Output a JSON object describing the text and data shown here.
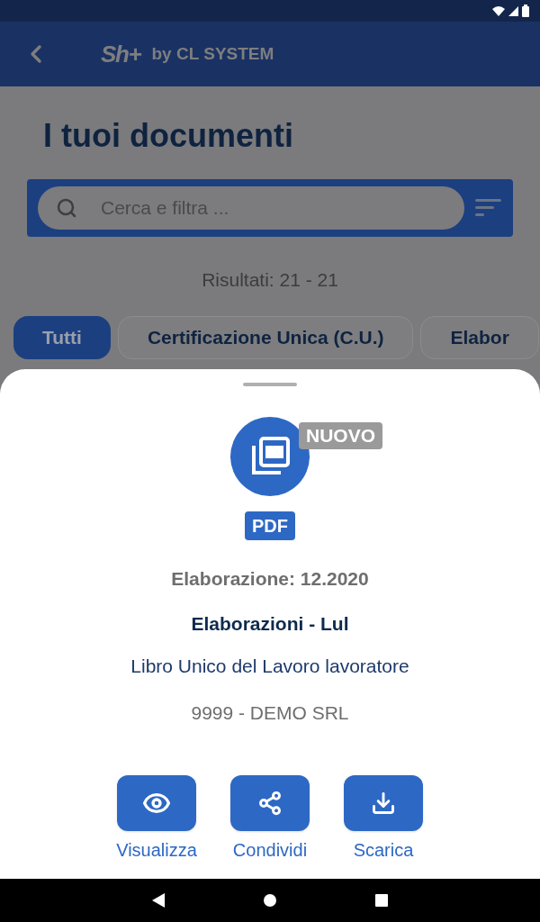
{
  "app_bar": {
    "logo": "Sh+",
    "title": "by CL SYSTEM"
  },
  "page_title": "I tuoi documenti",
  "search": {
    "placeholder": "Cerca e filtra ..."
  },
  "results": "Risultati: 21 - 21",
  "filters": [
    {
      "label": "Tutti",
      "selected": true
    },
    {
      "label": "Certificazione Unica (C.U.)",
      "selected": false
    },
    {
      "label": "Elabor",
      "selected": false
    }
  ],
  "sheet": {
    "badge": "NUOVO",
    "file_type": "PDF",
    "period": "Elaborazione: 12.2020",
    "title": "Elaborazioni - Lul",
    "description": "Libro Unico del Lavoro lavoratore",
    "company": "9999 - DEMO SRL",
    "actions": [
      {
        "kind": "view",
        "label": "Visualizza"
      },
      {
        "kind": "share",
        "label": "Condividi"
      },
      {
        "kind": "download",
        "label": "Scarica"
      }
    ]
  }
}
